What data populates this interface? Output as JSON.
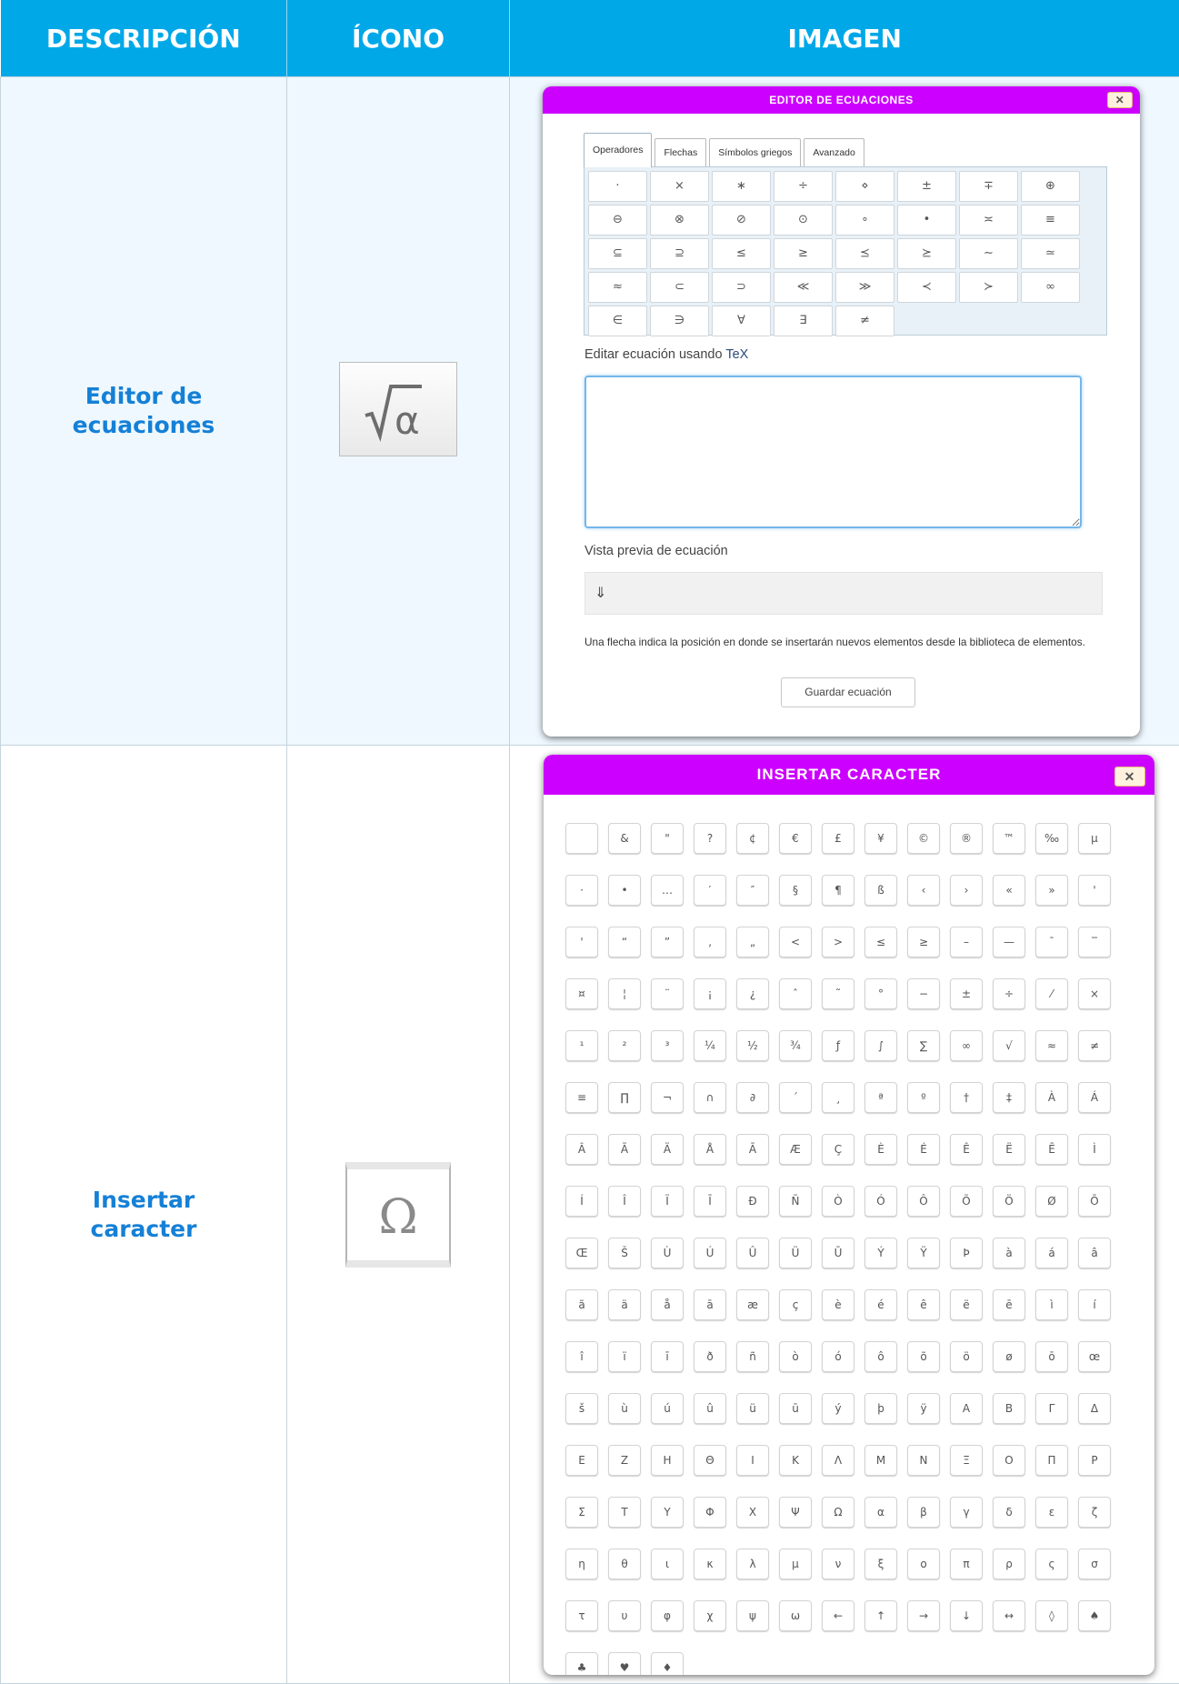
{
  "headers": {
    "descripcion": "DESCRIPCIÓN",
    "icono": "ÍCONO",
    "imagen": "IMAGEN"
  },
  "rows": [
    {
      "description": "Editor de ecuaciones",
      "icon": "sqrt-alpha-icon"
    },
    {
      "description": "Insertar caracter",
      "icon": "omega-icon"
    }
  ],
  "equation_editor": {
    "title": "EDITOR DE ECUACIONES",
    "close_label": "✕",
    "tabs": [
      "Operadores",
      "Flechas",
      "Símbolos griegos",
      "Avanzado"
    ],
    "active_tab": "Operadores",
    "operators": [
      "·",
      "×",
      "∗",
      "÷",
      "⋄",
      "±",
      "∓",
      "⊕",
      "⊖",
      "⊗",
      "⊘",
      "⊙",
      "∘",
      "•",
      "≍",
      "≡",
      "⊆",
      "⊇",
      "≤",
      "≥",
      "⪯",
      "⪰",
      "∼",
      "≃",
      "≈",
      "⊂",
      "⊃",
      "≪",
      "≫",
      "≺",
      "≻",
      "∞",
      "∈",
      "∋",
      "∀",
      "∃",
      "≠"
    ],
    "edit_label": "Editar ecuación usando",
    "edit_label_tex": "TeX",
    "textarea_value": "",
    "preview_label": "Vista previa de ecuación",
    "preview_value": "⇓",
    "help_text": "Una flecha indica la posición en donde se insertarán nuevos elementos desde la biblioteca de elementos.",
    "save_label": "Guardar ecuación"
  },
  "insert_character": {
    "title": "INSERTAR CARACTER",
    "close_label": "✕",
    "characters": [
      " ",
      "&",
      "\"",
      "?",
      "¢",
      "€",
      "£",
      "¥",
      "©",
      "®",
      "™",
      "‰",
      "µ",
      "·",
      "•",
      "…",
      "′",
      "″",
      "§",
      "¶",
      "ß",
      "‹",
      "›",
      "«",
      "»",
      "'",
      "'",
      "“",
      "”",
      "‚",
      "„",
      "<",
      ">",
      "≤",
      "≥",
      "–",
      "—",
      "¯",
      "‾",
      "¤",
      "¦",
      "¨",
      "¡",
      "¿",
      "ˆ",
      "˜",
      "°",
      "−",
      "±",
      "÷",
      "⁄",
      "×",
      "¹",
      "²",
      "³",
      "¼",
      "½",
      "¾",
      "ƒ",
      "∫",
      "∑",
      "∞",
      "√",
      "≈",
      "≠",
      "≡",
      "∏",
      "¬",
      "∩",
      "∂",
      "´",
      "¸",
      "ª",
      "º",
      "†",
      "‡",
      "À",
      "Á",
      "Â",
      "Ã",
      "Ä",
      "Å",
      "Ā",
      "Æ",
      "Ç",
      "È",
      "É",
      "Ê",
      "Ë",
      "Ē",
      "Ì",
      "Í",
      "Î",
      "Ï",
      "Ī",
      "Ð",
      "Ñ",
      "Ò",
      "Ó",
      "Ô",
      "Õ",
      "Ö",
      "Ø",
      "Ō",
      "Œ",
      "Š",
      "Ù",
      "Ú",
      "Û",
      "Ü",
      "Ū",
      "Ý",
      "Ÿ",
      "Þ",
      "à",
      "á",
      "â",
      "ã",
      "ä",
      "å",
      "ā",
      "æ",
      "ç",
      "è",
      "é",
      "ê",
      "ë",
      "ē",
      "ì",
      "í",
      "î",
      "ï",
      "ī",
      "ð",
      "ñ",
      "ò",
      "ó",
      "ô",
      "õ",
      "ö",
      "ø",
      "ō",
      "œ",
      "š",
      "ù",
      "ú",
      "û",
      "ü",
      "ū",
      "ý",
      "þ",
      "ÿ",
      "Α",
      "Β",
      "Γ",
      "Δ",
      "Ε",
      "Ζ",
      "Η",
      "Θ",
      "Ι",
      "Κ",
      "Λ",
      "Μ",
      "Ν",
      "Ξ",
      "Ο",
      "Π",
      "Ρ",
      "Σ",
      "Τ",
      "Υ",
      "Φ",
      "Χ",
      "Ψ",
      "Ω",
      "α",
      "β",
      "γ",
      "δ",
      "ε",
      "ζ",
      "η",
      "θ",
      "ι",
      "κ",
      "λ",
      "μ",
      "ν",
      "ξ",
      "ο",
      "π",
      "ρ",
      "ς",
      "σ",
      "τ",
      "υ",
      "φ",
      "χ",
      "ψ",
      "ω",
      "←",
      "↑",
      "→",
      "↓",
      "↔",
      "◊",
      "♠",
      "♣",
      "♥",
      "♦"
    ]
  },
  "colors": {
    "header_bg": "#00a8e8",
    "description_text": "#1580d6",
    "dialog_title_bg": "#cc00ff"
  }
}
